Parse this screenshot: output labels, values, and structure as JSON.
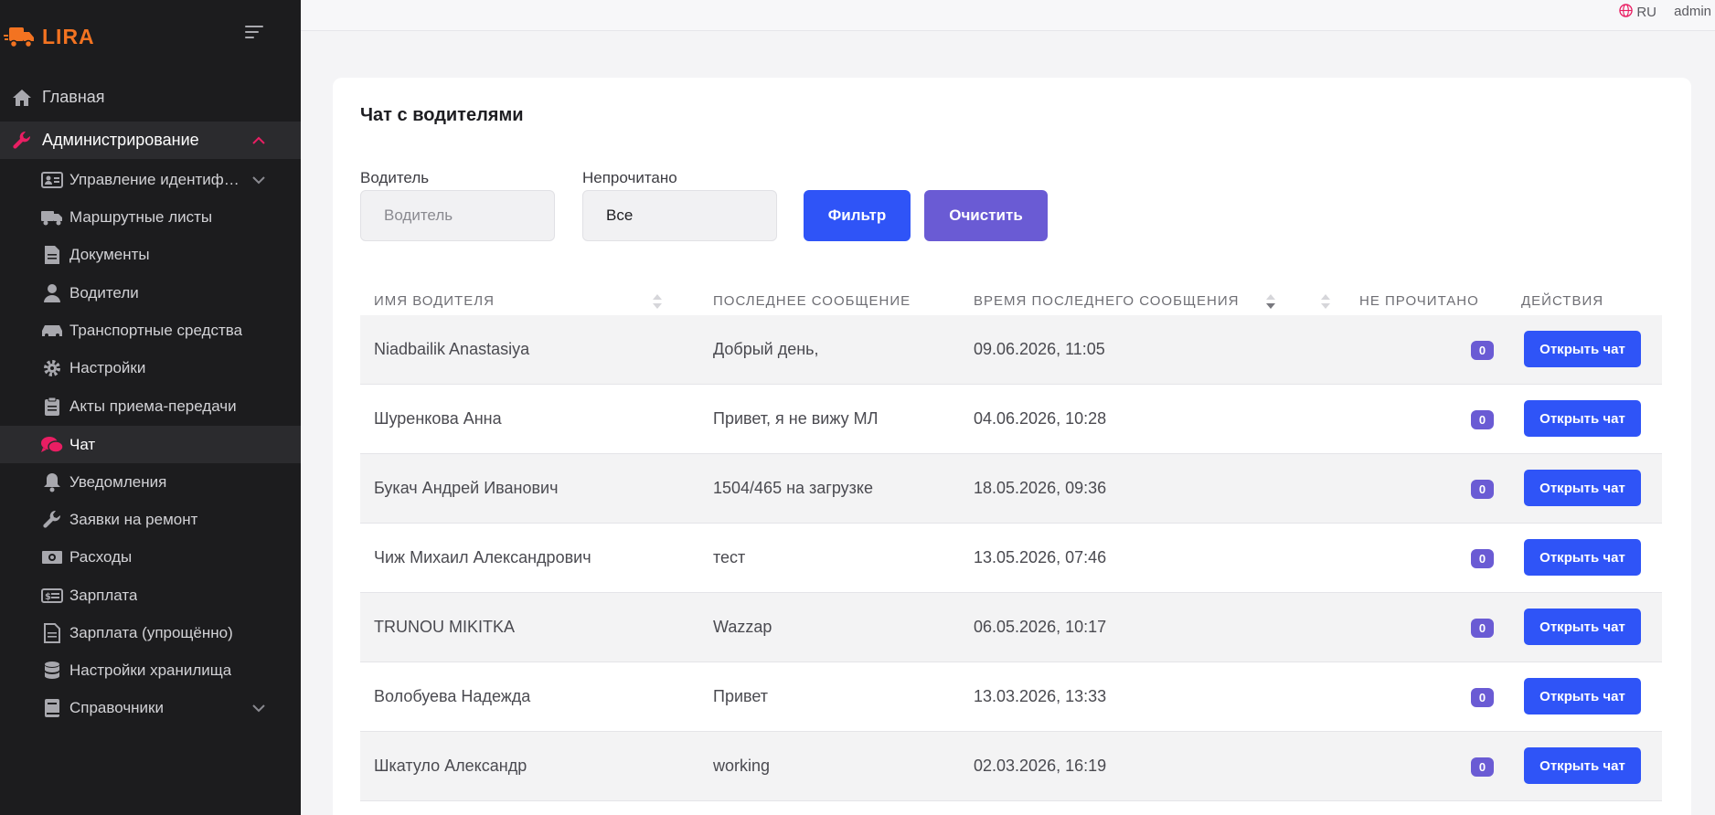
{
  "app": {
    "brand": "LIRA"
  },
  "topbar": {
    "language": "RU",
    "user": "admin"
  },
  "sidebar": {
    "items": [
      {
        "label": "Главная",
        "icon": "home-icon"
      },
      {
        "label": "Администрирование",
        "icon": "wrench-icon",
        "expanded": true
      },
      {
        "label": "Управление идентиф…",
        "icon": "id-card-icon",
        "has_children": true
      },
      {
        "label": "Маршрутные листы",
        "icon": "truck-icon"
      },
      {
        "label": "Документы",
        "icon": "document-icon"
      },
      {
        "label": "Водители",
        "icon": "driver-icon"
      },
      {
        "label": "Транспортные средства",
        "icon": "car-icon"
      },
      {
        "label": "Настройки",
        "icon": "gear-icon"
      },
      {
        "label": "Акты приема-передачи",
        "icon": "clipboard-icon"
      },
      {
        "label": "Чат",
        "icon": "chat-icon",
        "active": true
      },
      {
        "label": "Уведомления",
        "icon": "bell-icon"
      },
      {
        "label": "Заявки на ремонт",
        "icon": "wrench-icon"
      },
      {
        "label": "Расходы",
        "icon": "money-icon"
      },
      {
        "label": "Зарплата",
        "icon": "salary-icon"
      },
      {
        "label": "Зарплата (упрощённо)",
        "icon": "document-icon"
      },
      {
        "label": "Настройки хранилища",
        "icon": "database-icon"
      },
      {
        "label": "Справочники",
        "icon": "book-icon",
        "has_children": true
      }
    ]
  },
  "page": {
    "title": "Чат с водителями",
    "filters": {
      "driver_label": "Водитель",
      "driver_placeholder": "Водитель",
      "unread_label": "Непрочитано",
      "unread_value": "Все",
      "filter_button": "Фильтр",
      "clear_button": "Очистить"
    },
    "table": {
      "columns": [
        "ИМЯ ВОДИТЕЛЯ",
        "ПОСЛЕДНЕЕ СООБЩЕНИЕ",
        "ВРЕМЯ ПОСЛЕДНЕГО СООБЩЕНИЯ",
        "НЕ ПРОЧИТАНО",
        "ДЕЙСТВИЯ"
      ],
      "action_label": "Открыть чат",
      "rows": [
        {
          "driver": "Niadbailik Anastasiya",
          "message": "Добрый день,",
          "time": "09.06.2026, 11:05",
          "unread": "0"
        },
        {
          "driver": "Шуренкова Анна",
          "message": "Привет, я не вижу МЛ",
          "time": "04.06.2026, 10:28",
          "unread": "0"
        },
        {
          "driver": "Букач Андрей Иванович",
          "message": "1504/465 на загрузке",
          "time": "18.05.2026, 09:36",
          "unread": "0"
        },
        {
          "driver": "Чиж Михаил Александрович",
          "message": "тест",
          "time": "13.05.2026, 07:46",
          "unread": "0"
        },
        {
          "driver": "TRUNOU MIKITKA",
          "message": "Wazzap",
          "time": "06.05.2026, 10:17",
          "unread": "0"
        },
        {
          "driver": "Волобуева Надежда",
          "message": "Привет",
          "time": "13.03.2026, 13:33",
          "unread": "0"
        },
        {
          "driver": "Шкатуло Александр",
          "message": "working",
          "time": "02.03.2026, 16:19",
          "unread": "0"
        }
      ]
    }
  },
  "colors": {
    "sidebar_bg": "#1c1c1e",
    "brand": "#f37321",
    "accent_pink": "#e91e63",
    "primary_button": "#2f54f7",
    "clear_button": "#6a5bd4",
    "badge": "#6a5bd4"
  }
}
